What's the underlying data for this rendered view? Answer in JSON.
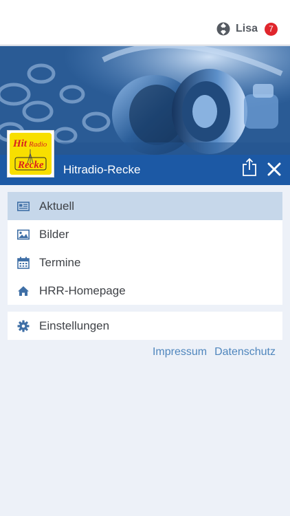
{
  "header": {
    "user_name": "Lisa",
    "notification_count": "7"
  },
  "station": {
    "title": "Hitradio-Recke",
    "logo_text": "Hit Radio Recke"
  },
  "menu": {
    "main_items": [
      {
        "label": "Aktuell",
        "icon": "newspaper-icon",
        "active": true
      },
      {
        "label": "Bilder",
        "icon": "image-icon",
        "active": false
      },
      {
        "label": "Termine",
        "icon": "calendar-icon",
        "active": false
      },
      {
        "label": "HRR-Homepage",
        "icon": "home-icon",
        "active": false
      }
    ],
    "settings_items": [
      {
        "label": "Einstellungen",
        "icon": "gear-icon"
      }
    ]
  },
  "footer": {
    "impressum": "Impressum",
    "datenschutz": "Datenschutz"
  },
  "colors": {
    "brand_blue": "#1c59a5",
    "active_bg": "#c6d7ea",
    "icon_blue": "#3f6fa6",
    "badge_red": "#e0262c",
    "link_blue": "#4f86bd",
    "background": "#edf1f8"
  }
}
